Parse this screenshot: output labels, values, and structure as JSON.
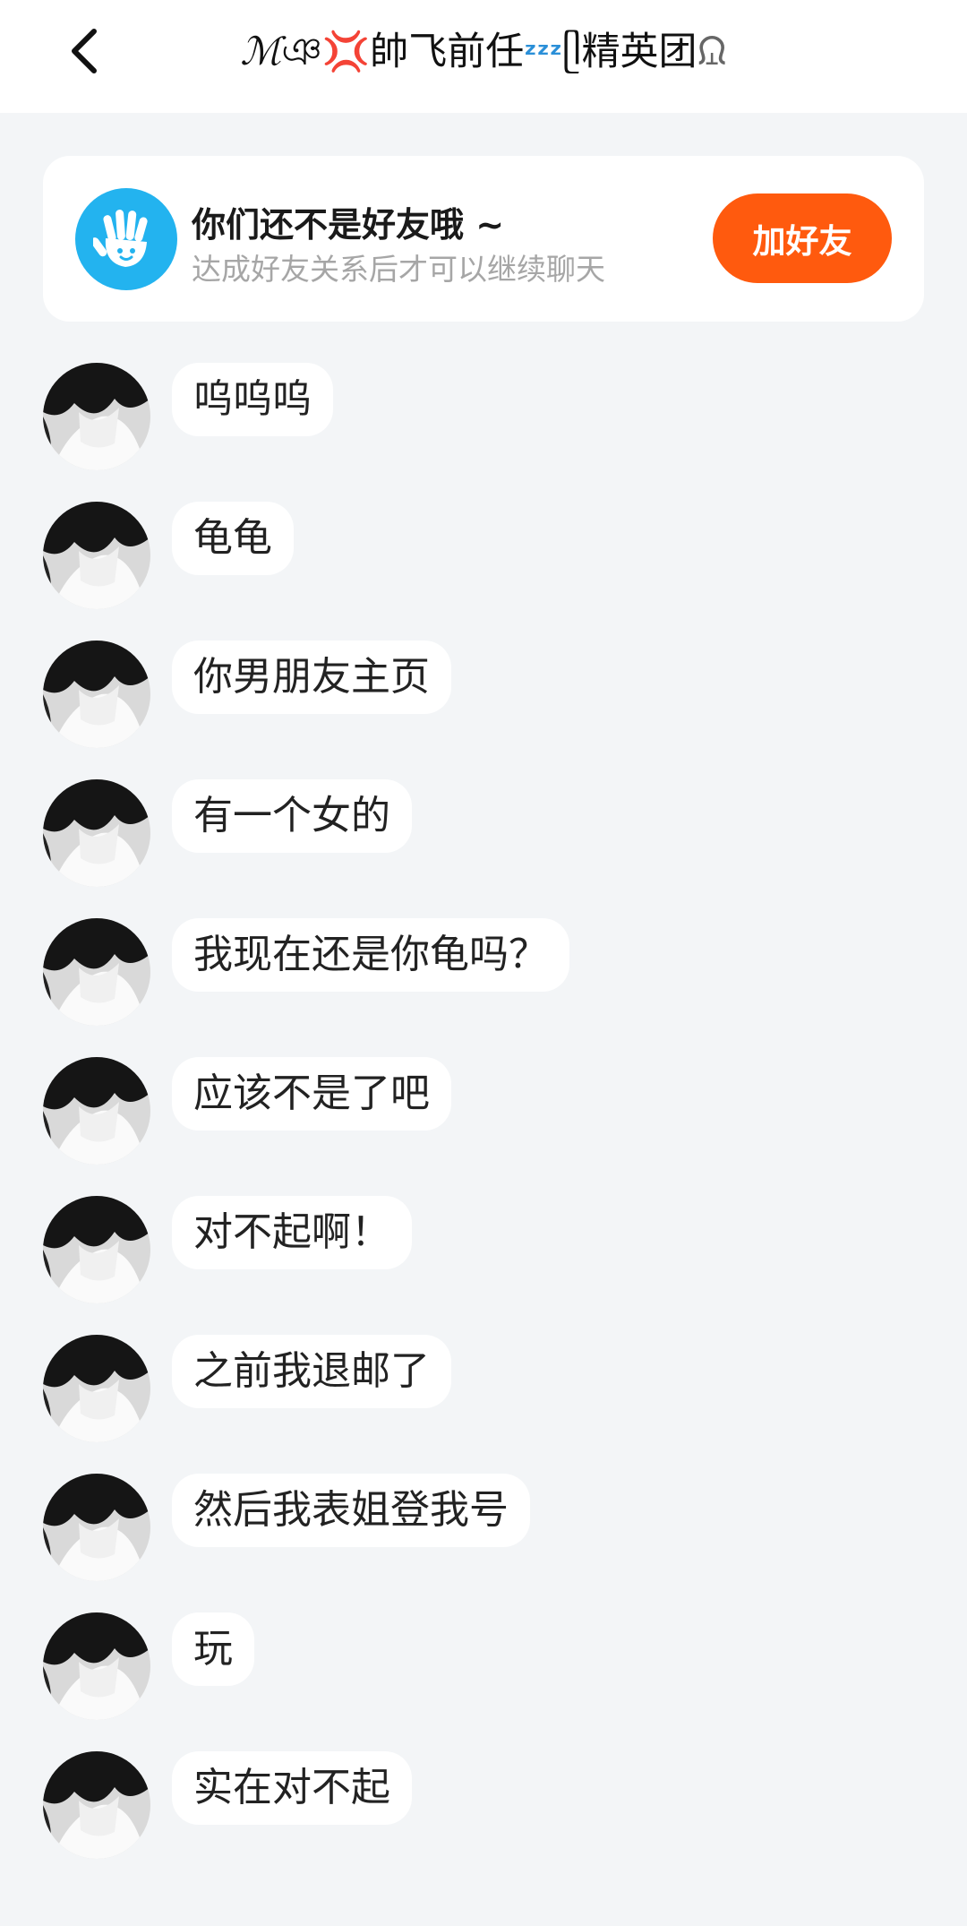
{
  "header": {
    "back_icon": "chevron-left-icon",
    "title_prefix": "ℳ",
    "title_bracket_open": "ঞ",
    "title_emoji_anger": "💢",
    "title_main": "帥飞前任",
    "title_emoji_zzz": "ᶻᶻᶻ",
    "title_bracket_mid": "ᥫ",
    "title_suffix": "精英团",
    "title_bracket_close": "ᙉ"
  },
  "friend_notice": {
    "icon": "waving-hand-icon",
    "title": "你们还不是好友哦 ~",
    "subtitle": "达成好友关系后才可以继续聊天",
    "button_label": "加好友",
    "accent_color": "#ff5a0e",
    "icon_color": "#23b3ef"
  },
  "messages": [
    {
      "text": "呜呜呜"
    },
    {
      "text": "龟龟"
    },
    {
      "text": "你男朋友主页"
    },
    {
      "text": "有一个女的"
    },
    {
      "text": "我现在还是你龟吗？"
    },
    {
      "text": "应该不是了吧"
    },
    {
      "text": "对不起啊！"
    },
    {
      "text": "之前我退邮了"
    },
    {
      "text": "然后我表姐登我号"
    },
    {
      "text": "玩"
    },
    {
      "text": "实在对不起"
    }
  ]
}
